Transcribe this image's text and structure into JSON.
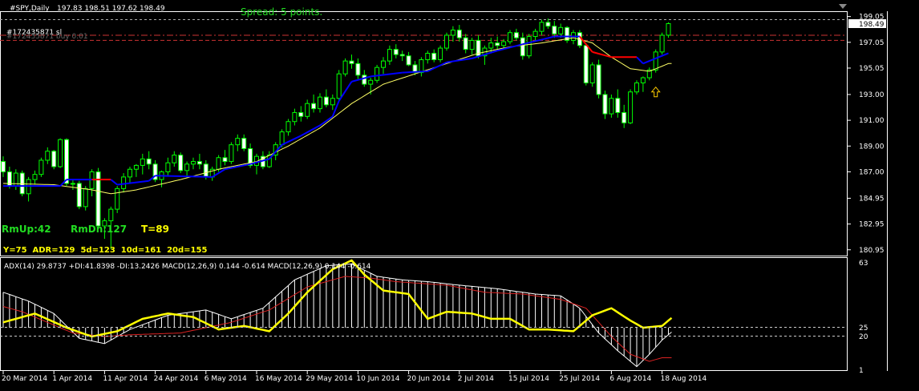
{
  "header": {
    "symbol": "#SPY,Daily",
    "ohlc": "197.83 198.51 197.62 198.49",
    "spread": "Spread: 5 points.",
    "order_line_1": "#172435871 sl",
    "order_line_2": "#172435871 buy 0.01"
  },
  "stats": {
    "line1": [
      {
        "text": "RmUp:42",
        "color": "#22dd22"
      },
      {
        "text": "RmDn:127",
        "color": "#22dd22"
      },
      {
        "text": "T=89",
        "color": "#ffff00"
      }
    ],
    "line2": "Y=75  ADR=129  5d=123  10d=161  20d=155"
  },
  "indicator_header": "ADX(14) 29.8737 +DI:41.8398 -DI:13.2426  MACD(12,26,9) 0.144 -0.614  MACD(12,26,9) 0.144 -0.614",
  "price_axis": {
    "ticks": [
      "199.05",
      "197.05",
      "195.05",
      "193.00",
      "191.00",
      "189.00",
      "187.00",
      "184.95",
      "182.95",
      "180.95"
    ],
    "current_price": "198.49"
  },
  "indicator_axis": {
    "ticks": [
      "63",
      "25",
      "20",
      "1"
    ]
  },
  "time_axis": {
    "labels": [
      "20 Mar 2014",
      "1 Apr 2014",
      "11 Apr 2014",
      "24 Apr 2014",
      "6 May 2014",
      "16 May 2014",
      "29 May 2014",
      "10 Jun 2014",
      "20 Jun 2014",
      "2 Jul 2014",
      "15 Jul 2014",
      "25 Jul 2014",
      "6 Aug 2014",
      "18 Aug 2014"
    ]
  },
  "colors": {
    "background": "#000000",
    "candle_up": "#000000",
    "candle_down": "#ffffff",
    "wick": "#00ff00",
    "trail_up": "#0000ff",
    "trail_down": "#ff0000",
    "moving_average": "#ffff66",
    "adx_line": "#ffff00",
    "di_line": "#dd2222",
    "histogram": "#ffffff",
    "order_line": "#cc3333",
    "spread_text": "#22dd22",
    "arrow": "#ffcc00"
  },
  "chart_data": {
    "type": "candlestick",
    "ylim": [
      180.5,
      199.4
    ],
    "candles": [
      [
        187.8,
        188.2,
        186.6,
        187.0
      ],
      [
        187.0,
        187.4,
        185.7,
        185.9
      ],
      [
        185.9,
        187.2,
        185.6,
        186.9
      ],
      [
        186.9,
        187.1,
        185.1,
        185.3
      ],
      [
        185.3,
        186.6,
        184.7,
        186.4
      ],
      [
        186.4,
        187.1,
        186.0,
        186.8
      ],
      [
        186.8,
        188.1,
        186.6,
        187.9
      ],
      [
        187.9,
        188.9,
        187.6,
        188.6
      ],
      [
        188.6,
        188.7,
        187.2,
        187.4
      ],
      [
        187.4,
        189.6,
        187.3,
        189.5
      ],
      [
        189.5,
        189.6,
        185.9,
        186.1
      ],
      [
        186.1,
        186.4,
        185.6,
        186.1
      ],
      [
        186.1,
        186.3,
        184.1,
        184.3
      ],
      [
        184.3,
        185.9,
        184.0,
        185.7
      ],
      [
        185.7,
        187.2,
        185.1,
        187.0
      ],
      [
        187.0,
        187.3,
        182.6,
        182.8
      ],
      [
        182.8,
        183.4,
        181.8,
        183.2
      ],
      [
        183.2,
        184.3,
        181.0,
        184.1
      ],
      [
        184.1,
        185.9,
        183.8,
        185.7
      ],
      [
        185.7,
        186.9,
        185.4,
        186.6
      ],
      [
        186.6,
        187.4,
        186.1,
        187.2
      ],
      [
        187.2,
        187.6,
        186.6,
        187.5
      ],
      [
        187.5,
        188.4,
        186.8,
        188.0
      ],
      [
        188.0,
        188.6,
        187.2,
        187.6
      ],
      [
        187.6,
        187.9,
        186.2,
        186.4
      ],
      [
        186.4,
        187.1,
        185.8,
        187.0
      ],
      [
        187.0,
        188.1,
        186.7,
        187.7
      ],
      [
        187.7,
        188.6,
        187.4,
        188.3
      ],
      [
        188.3,
        188.5,
        186.9,
        187.1
      ],
      [
        187.1,
        187.8,
        186.5,
        187.6
      ],
      [
        187.6,
        188.1,
        187.2,
        187.8
      ],
      [
        187.8,
        188.4,
        187.2,
        187.6
      ],
      [
        187.6,
        187.9,
        186.4,
        186.6
      ],
      [
        186.6,
        187.4,
        186.3,
        187.2
      ],
      [
        187.2,
        188.3,
        187.0,
        188.1
      ],
      [
        188.1,
        188.7,
        187.5,
        187.8
      ],
      [
        187.8,
        189.3,
        187.6,
        189.1
      ],
      [
        189.1,
        189.9,
        188.6,
        189.6
      ],
      [
        189.6,
        189.9,
        188.6,
        188.8
      ],
      [
        188.8,
        189.2,
        187.3,
        187.5
      ],
      [
        187.5,
        188.4,
        186.8,
        188.2
      ],
      [
        188.2,
        188.6,
        187.2,
        187.4
      ],
      [
        187.4,
        188.6,
        187.3,
        188.3
      ],
      [
        188.3,
        189.3,
        187.9,
        189.1
      ],
      [
        189.1,
        190.3,
        188.9,
        190.1
      ],
      [
        190.1,
        191.1,
        189.8,
        190.9
      ],
      [
        190.9,
        191.9,
        190.6,
        191.6
      ],
      [
        191.6,
        192.1,
        190.9,
        191.3
      ],
      [
        191.3,
        192.6,
        191.1,
        192.3
      ],
      [
        192.3,
        193.0,
        191.6,
        191.9
      ],
      [
        191.9,
        193.1,
        191.6,
        192.8
      ],
      [
        192.8,
        193.4,
        192.0,
        192.2
      ],
      [
        192.2,
        193.0,
        191.8,
        192.7
      ],
      [
        192.7,
        194.9,
        192.5,
        194.6
      ],
      [
        194.6,
        195.8,
        194.4,
        195.6
      ],
      [
        195.6,
        196.1,
        195.0,
        195.4
      ],
      [
        195.4,
        195.8,
        194.2,
        194.5
      ],
      [
        194.5,
        194.9,
        193.6,
        193.8
      ],
      [
        193.8,
        194.3,
        193.0,
        194.1
      ],
      [
        194.1,
        195.3,
        193.9,
        195.1
      ],
      [
        195.1,
        195.9,
        194.6,
        195.6
      ],
      [
        195.6,
        196.8,
        195.3,
        196.5
      ],
      [
        196.5,
        196.9,
        195.8,
        196.1
      ],
      [
        196.1,
        196.4,
        195.6,
        196.0
      ],
      [
        196.0,
        196.3,
        195.2,
        195.3
      ],
      [
        195.3,
        195.6,
        194.5,
        194.7
      ],
      [
        194.7,
        195.9,
        194.4,
        195.7
      ],
      [
        195.7,
        196.4,
        195.4,
        196.2
      ],
      [
        196.2,
        196.5,
        195.5,
        195.7
      ],
      [
        195.7,
        196.8,
        195.5,
        196.6
      ],
      [
        196.6,
        197.8,
        196.4,
        197.6
      ],
      [
        197.6,
        198.3,
        197.1,
        198.0
      ],
      [
        198.0,
        198.4,
        197.1,
        197.4
      ],
      [
        197.4,
        197.7,
        196.2,
        196.5
      ],
      [
        196.5,
        197.4,
        196.1,
        197.2
      ],
      [
        197.2,
        197.6,
        195.8,
        196.0
      ],
      [
        196.0,
        196.8,
        195.3,
        196.6
      ],
      [
        196.6,
        197.4,
        196.3,
        197.0
      ],
      [
        197.0,
        197.5,
        196.5,
        196.8
      ],
      [
        196.8,
        197.3,
        196.5,
        197.1
      ],
      [
        197.1,
        198.0,
        196.9,
        197.8
      ],
      [
        197.8,
        198.1,
        197.2,
        197.4
      ],
      [
        197.4,
        197.8,
        195.7,
        196.0
      ],
      [
        196.0,
        197.7,
        195.8,
        197.5
      ],
      [
        197.5,
        198.1,
        197.1,
        197.9
      ],
      [
        197.9,
        198.8,
        197.6,
        198.6
      ],
      [
        198.6,
        198.9,
        198.1,
        198.3
      ],
      [
        198.3,
        198.7,
        197.4,
        197.7
      ],
      [
        197.7,
        198.5,
        197.4,
        198.2
      ],
      [
        198.2,
        198.3,
        197.0,
        197.2
      ],
      [
        197.2,
        198.0,
        196.9,
        197.8
      ],
      [
        197.8,
        198.0,
        196.6,
        196.8
      ],
      [
        196.8,
        197.0,
        193.7,
        193.9
      ],
      [
        193.9,
        195.5,
        193.6,
        195.3
      ],
      [
        195.3,
        195.7,
        192.7,
        193.0
      ],
      [
        193.0,
        193.3,
        191.1,
        191.5
      ],
      [
        191.5,
        193.0,
        191.2,
        192.7
      ],
      [
        192.7,
        193.4,
        191.2,
        191.6
      ],
      [
        191.6,
        192.2,
        190.4,
        190.8
      ],
      [
        190.8,
        193.4,
        190.7,
        193.2
      ],
      [
        193.2,
        194.1,
        193.0,
        193.9
      ],
      [
        193.9,
        194.4,
        193.2,
        194.3
      ],
      [
        194.3,
        195.1,
        194.1,
        194.9
      ],
      [
        194.9,
        196.5,
        194.7,
        196.3
      ],
      [
        196.3,
        197.8,
        196.1,
        197.6
      ],
      [
        197.6,
        198.6,
        197.4,
        198.5
      ]
    ],
    "trail_stop": [
      [
        0,
        185.9,
        "u"
      ],
      [
        9,
        185.9,
        "u"
      ],
      [
        10,
        186.4,
        "u"
      ],
      [
        14,
        186.4,
        "u"
      ],
      [
        15,
        186.4,
        "d"
      ],
      [
        17,
        186.4,
        "d"
      ],
      [
        18,
        186.0,
        "u"
      ],
      [
        23,
        186.3,
        "u"
      ],
      [
        24,
        186.7,
        "u"
      ],
      [
        33,
        186.6,
        "u"
      ],
      [
        35,
        187.2,
        "u"
      ],
      [
        39,
        187.6,
        "u"
      ],
      [
        42,
        188.0,
        "u"
      ],
      [
        44,
        189.1,
        "u"
      ],
      [
        47,
        189.8,
        "u"
      ],
      [
        50,
        190.6,
        "u"
      ],
      [
        52,
        191.3,
        "u"
      ],
      [
        53,
        192.5,
        "u"
      ],
      [
        55,
        194.0,
        "u"
      ],
      [
        58,
        194.4,
        "u"
      ],
      [
        63,
        194.7,
        "u"
      ],
      [
        67,
        194.8,
        "u"
      ],
      [
        70,
        195.5,
        "u"
      ],
      [
        74,
        195.8,
        "u"
      ],
      [
        78,
        196.4,
        "u"
      ],
      [
        82,
        196.9,
        "u"
      ],
      [
        87,
        197.5,
        "u"
      ],
      [
        91,
        197.5,
        "u"
      ],
      [
        91,
        197.5,
        "d"
      ],
      [
        93,
        196.3,
        "d"
      ],
      [
        96,
        195.9,
        "d"
      ],
      [
        100,
        195.9,
        "d"
      ],
      [
        101,
        195.4,
        "u"
      ],
      [
        105,
        196.2,
        "u"
      ]
    ],
    "moving_average": [
      [
        0,
        186.1
      ],
      [
        8,
        186.0
      ],
      [
        14,
        185.6
      ],
      [
        17,
        185.3
      ],
      [
        21,
        185.6
      ],
      [
        28,
        186.4
      ],
      [
        34,
        187.2
      ],
      [
        40,
        187.8
      ],
      [
        45,
        189.0
      ],
      [
        50,
        190.4
      ],
      [
        55,
        192.3
      ],
      [
        60,
        193.8
      ],
      [
        65,
        194.6
      ],
      [
        70,
        195.4
      ],
      [
        75,
        196.2
      ],
      [
        80,
        196.7
      ],
      [
        85,
        197.0
      ],
      [
        90,
        197.4
      ],
      [
        93,
        197.0
      ],
      [
        96,
        195.9
      ],
      [
        99,
        195.0
      ],
      [
        102,
        194.8
      ],
      [
        105,
        195.4
      ]
    ],
    "orders": [
      {
        "label": "sl",
        "price": 197.6
      },
      {
        "label": "buy",
        "price": 197.2
      }
    ],
    "arrow": {
      "index": 103,
      "price": 193.2
    },
    "adx": [
      [
        0,
        28
      ],
      [
        5,
        33
      ],
      [
        10,
        25
      ],
      [
        14,
        20
      ],
      [
        18,
        23
      ],
      [
        22,
        30
      ],
      [
        26,
        33
      ],
      [
        30,
        31
      ],
      [
        34,
        24
      ],
      [
        38,
        26
      ],
      [
        42,
        23
      ],
      [
        45,
        33
      ],
      [
        48,
        45
      ],
      [
        52,
        58
      ],
      [
        55,
        63
      ],
      [
        57,
        55
      ],
      [
        60,
        46
      ],
      [
        64,
        44
      ],
      [
        67,
        30
      ],
      [
        70,
        34
      ],
      [
        74,
        33
      ],
      [
        77,
        30
      ],
      [
        80,
        30
      ],
      [
        83,
        24
      ],
      [
        86,
        24
      ],
      [
        90,
        23
      ],
      [
        93,
        32
      ],
      [
        96,
        36
      ],
      [
        99,
        29
      ],
      [
        101,
        25
      ],
      [
        104,
        26
      ],
      [
        106,
        32
      ]
    ],
    "di": [
      [
        0,
        37
      ],
      [
        3,
        34
      ],
      [
        7,
        28
      ],
      [
        11,
        22
      ],
      [
        16,
        20
      ],
      [
        20,
        21
      ],
      [
        28,
        22
      ],
      [
        36,
        28
      ],
      [
        42,
        35
      ],
      [
        48,
        48
      ],
      [
        54,
        54
      ],
      [
        58,
        53
      ],
      [
        62,
        51
      ],
      [
        66,
        50
      ],
      [
        70,
        49
      ],
      [
        76,
        45
      ],
      [
        82,
        44
      ],
      [
        88,
        41
      ],
      [
        92,
        36
      ],
      [
        96,
        20
      ],
      [
        99,
        10
      ],
      [
        102,
        6
      ],
      [
        104,
        8
      ],
      [
        106,
        8
      ]
    ],
    "histogram_top": [
      [
        0,
        45
      ],
      [
        4,
        40
      ],
      [
        8,
        33
      ],
      [
        12,
        19
      ],
      [
        16,
        16
      ],
      [
        20,
        24
      ],
      [
        26,
        32
      ],
      [
        32,
        35
      ],
      [
        36,
        30
      ],
      [
        41,
        36
      ],
      [
        46,
        52
      ],
      [
        51,
        60
      ],
      [
        55,
        61
      ],
      [
        59,
        54
      ],
      [
        63,
        52
      ],
      [
        67,
        51
      ],
      [
        72,
        49
      ],
      [
        78,
        47
      ],
      [
        84,
        44
      ],
      [
        88,
        43
      ],
      [
        91,
        36
      ],
      [
        94,
        22
      ],
      [
        97,
        12
      ],
      [
        100,
        3
      ],
      [
        102,
        10
      ],
      [
        104,
        18
      ],
      [
        106,
        24
      ]
    ],
    "histogram_base": 25,
    "indicator_ylim": [
      1,
      63
    ]
  }
}
